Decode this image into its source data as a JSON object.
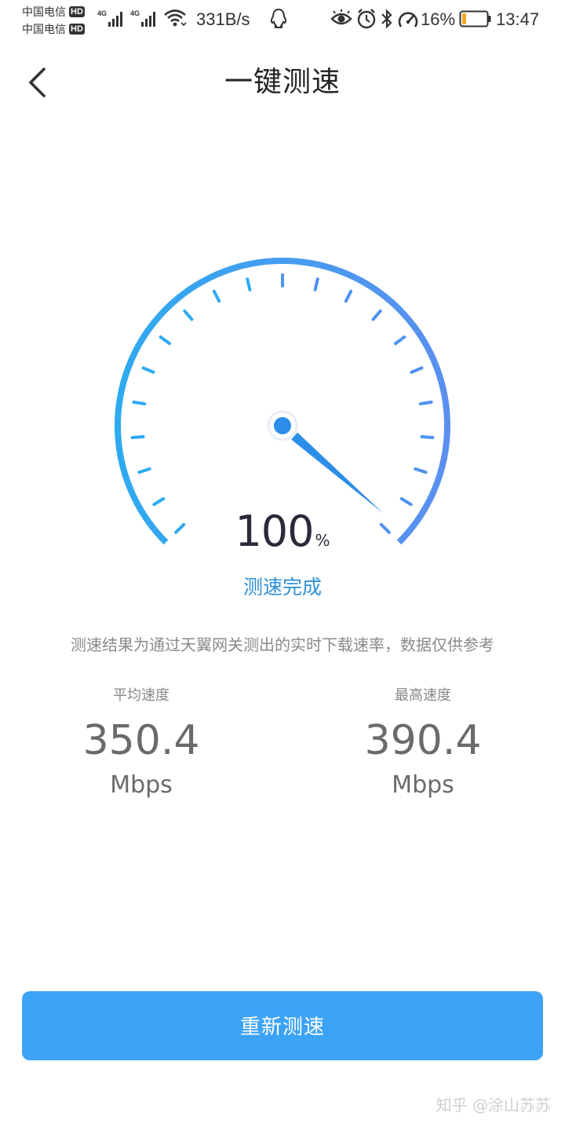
{
  "status_bar": {
    "carrier_1": "中国电信",
    "carrier_2": "中国电信",
    "hd_label": "HD",
    "network_tag": "4G",
    "net_speed": "331B/s",
    "battery_percent": "16%",
    "battery_level": 0.16,
    "battery_color": "#f5a623",
    "time": "13:47",
    "icons": [
      "wifi-icon",
      "qq-icon",
      "eye-icon",
      "alarm-icon",
      "bluetooth-icon",
      "speedometer-icon",
      "battery-icon"
    ]
  },
  "header": {
    "title": "一键测速",
    "back_icon": "chevron-left-icon"
  },
  "gauge": {
    "progress_value": "100",
    "progress_unit": "%",
    "status": "测速完成",
    "gradient_start": "#2eaaf0",
    "gradient_end": "#5b8ff0",
    "needle_color": "#2c8ee8"
  },
  "disclaimer": "测速结果为通过天翼网关测出的实时下载速率，数据仅供参考",
  "stats": {
    "average": {
      "label": "平均速度",
      "value": "350.4",
      "unit": "Mbps"
    },
    "max": {
      "label": "最高速度",
      "value": "390.4",
      "unit": "Mbps"
    }
  },
  "retest_button": {
    "label": "重新测速",
    "color": "#3ca3f7"
  },
  "watermark": "知乎 @涂山苏苏"
}
